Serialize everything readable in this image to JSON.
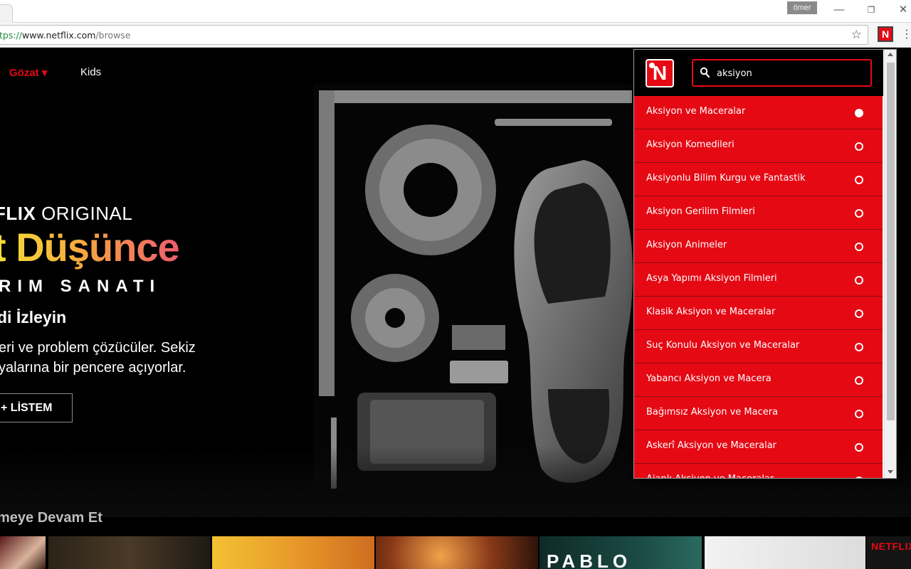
{
  "browser": {
    "user_name": "ömer",
    "url_scheme": "tps://",
    "url_host": "www.netflix.com",
    "url_path": "/browse"
  },
  "nav": {
    "browse_label": "Gözat ▾",
    "kids_label": "Kids"
  },
  "hero": {
    "brand_bold": "FLIX",
    "brand_light": " ORIGINAL",
    "title": "t Düşünce",
    "subtitle": "RIM SANATI",
    "watch_now": "di İzleyin",
    "synopsis": "eri ve problem çözücüler. Sekiz yalarına bir pencere açıyorlar.",
    "my_list_label": "+  LİSTEM"
  },
  "row": {
    "title": "meye Devam Et",
    "thumb_logo": "NETFLIX",
    "thumb_pablo": "PABLO"
  },
  "popup": {
    "logo_letter": "N",
    "search": {
      "value": "aksiyon",
      "placeholder": ""
    },
    "items": [
      {
        "label": "Aksiyon ve Maceralar",
        "selected": true
      },
      {
        "label": "Aksiyon Komedileri",
        "selected": false
      },
      {
        "label": "Aksiyonlu Bilim Kurgu ve Fantastik",
        "selected": false
      },
      {
        "label": "Aksiyon Gerilim Filmleri",
        "selected": false
      },
      {
        "label": "Aksiyon Animeler",
        "selected": false
      },
      {
        "label": "Asya Yapımı Aksiyon Filmleri",
        "selected": false
      },
      {
        "label": "Klasik Aksiyon ve Maceralar",
        "selected": false
      },
      {
        "label": "Suç Konulu Aksiyon ve Maceralar",
        "selected": false
      },
      {
        "label": "Yabancı Aksiyon ve Macera",
        "selected": false
      },
      {
        "label": "Bağımsız Aksiyon ve Macera",
        "selected": false
      },
      {
        "label": "Askerî Aksiyon ve Maceralar",
        "selected": false
      },
      {
        "label": "Ajanlı Aksiyon ve Maceralar",
        "selected": false
      }
    ]
  },
  "colors": {
    "netflix_red": "#e50914",
    "popup_header": "#000000"
  }
}
